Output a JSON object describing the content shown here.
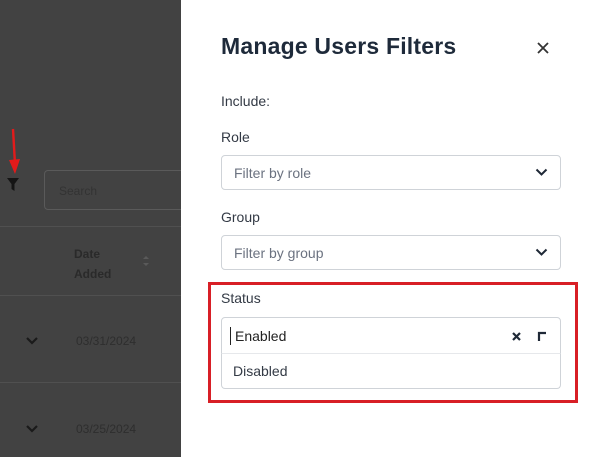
{
  "background": {
    "search_placeholder": "Search",
    "column_header": "Date Added",
    "rows": [
      {
        "date": "03/31/2024"
      },
      {
        "date": "03/25/2024"
      }
    ]
  },
  "drawer": {
    "title": "Manage Users Filters",
    "include_label": "Include:",
    "role": {
      "label": "Role",
      "placeholder": "Filter by role"
    },
    "group": {
      "label": "Group",
      "placeholder": "Filter by group"
    },
    "status": {
      "label": "Status",
      "selected_value": "Enabled",
      "options": [
        "Disabled"
      ]
    }
  },
  "icons": {
    "background_filter": "funnel-icon",
    "close": "close-icon",
    "dropdown": "chevron-down-icon",
    "clear": "clear-x-icon",
    "collapse": "corner-arrow-icon"
  },
  "colors": {
    "overlay": "#424242",
    "title": "#1e2a3a",
    "highlight": "#d81f26",
    "annotation_arrow": "#e21b1b"
  }
}
